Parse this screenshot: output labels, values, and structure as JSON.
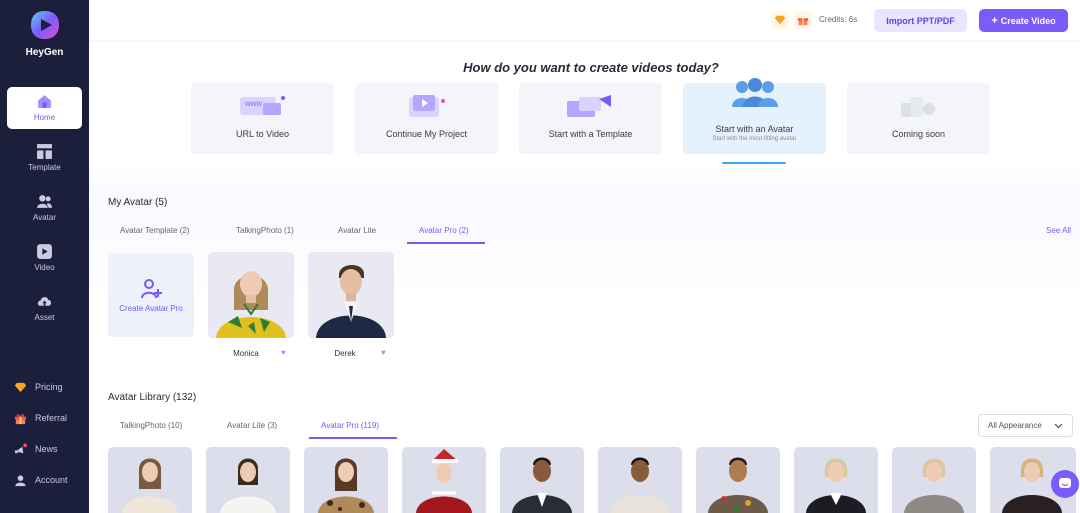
{
  "brand": {
    "name": "HeyGen"
  },
  "sidebar": {
    "items": [
      {
        "label": "Home",
        "icon": "home-icon"
      },
      {
        "label": "Template",
        "icon": "template-icon"
      },
      {
        "label": "Avatar",
        "icon": "avatar-icon"
      },
      {
        "label": "Video",
        "icon": "video-icon"
      },
      {
        "label": "Asset",
        "icon": "asset-icon"
      }
    ],
    "bottom": [
      {
        "label": "Pricing",
        "icon": "diamond-icon"
      },
      {
        "label": "Referral",
        "icon": "gift-icon"
      },
      {
        "label": "News",
        "icon": "news-icon"
      },
      {
        "label": "Account",
        "icon": "user-icon"
      }
    ]
  },
  "topbar": {
    "credits": "Credits: 6s",
    "import_label": "Import PPT/PDF",
    "create_label": "Create Video"
  },
  "question": "How do you want to create videos today?",
  "options": [
    {
      "label": "URL to Video"
    },
    {
      "label": "Continue My Project"
    },
    {
      "label": "Start with a Template"
    },
    {
      "label": "Start with an Avatar",
      "sub": "Start with the most fitting avatar"
    },
    {
      "label": "Coming soon"
    }
  ],
  "my_avatar": {
    "title": "My Avatar (5)",
    "tabs": [
      "Avatar Template (2)",
      "TalkingPhoto (1)",
      "Avatar Lite",
      "Avatar Pro (2)"
    ],
    "active_tab": "Avatar Pro (2)",
    "see_all": "See All",
    "create_label": "Create Avatar Pro",
    "avatars": [
      {
        "name": "Monica"
      },
      {
        "name": "Derek"
      }
    ]
  },
  "library": {
    "title": "Avatar Library (132)",
    "tabs": [
      "TalkingPhoto (10)",
      "Avatar Lite (3)",
      "Avatar Pro (119)"
    ],
    "active_tab": "Avatar Pro (119)",
    "filter": "All Appearance"
  },
  "colors": {
    "accent": "#7a5cfa",
    "sidebar": "#1b1f3b",
    "selected_card": "#e6f2fb"
  }
}
